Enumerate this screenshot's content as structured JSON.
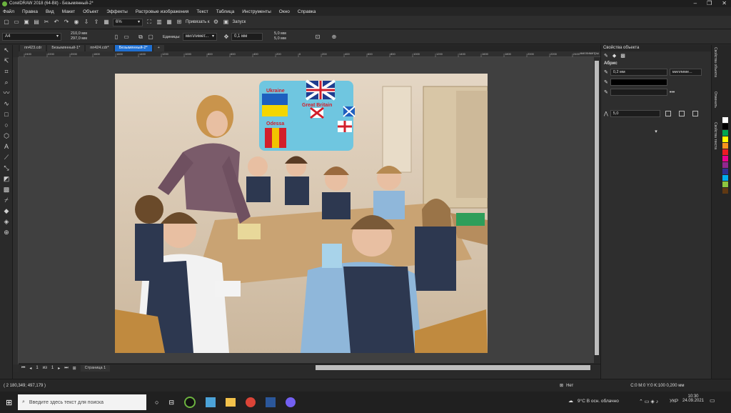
{
  "window": {
    "title": "CorelDRAW 2018 (64-Bit) - Безымянный-2*"
  },
  "menu": {
    "items": [
      "Файл",
      "Правка",
      "Вид",
      "Макет",
      "Объект",
      "Эффекты",
      "Растровые изображения",
      "Текст",
      "Таблица",
      "Инструменты",
      "Окно",
      "Справка"
    ]
  },
  "toolbar": {
    "zoom": "6%",
    "snap_label": "Привязать к",
    "launch_label": "Запуск"
  },
  "propbar": {
    "page_size": "A4",
    "width": "210,0 мм",
    "height": "297,0 мм",
    "units_label": "Единицы:",
    "units_value": "миллимет...",
    "nudge": "0,1 мм",
    "dup_x": "5,0 мм",
    "dup_y": "5,0 мм"
  },
  "tabs": [
    "пп423.cdr",
    "Безымянный-1*",
    "пп424.cdr*",
    "Безымянный-2*"
  ],
  "ruler": {
    "h_ticks": [
      "2400",
      "2200",
      "2000",
      "1800",
      "1600",
      "1400",
      "1200",
      "1000",
      "800",
      "600",
      "400",
      "200",
      "0",
      "200",
      "400",
      "600",
      "800",
      "1000",
      "1200",
      "1400",
      "1600",
      "1800",
      "2000",
      "2200",
      "2400"
    ],
    "units": "миллиметры"
  },
  "page_nav": {
    "current": "1",
    "of": "из",
    "total": "1",
    "page_tab": "Страница 1"
  },
  "photo": {
    "poster": {
      "ukraine": "Ukraine",
      "gb": "Great Britain",
      "odessa": "Odessa"
    }
  },
  "status": {
    "coords": "( 2 180,349; 497,179 )",
    "fill_none": "Нет",
    "outline": "C:0 M:0 Y:0 K:100  0,200 мм"
  },
  "dock": {
    "title": "Свойства объекта",
    "section": "Абрис",
    "outline_width": "0,2 мм",
    "outline_units": "миллиме...",
    "miter": "5,0"
  },
  "side_tabs": [
    "Свойства объекта",
    "Отменить",
    "Свойства текста"
  ],
  "palette_colors": [
    "#ffffff",
    "#000000",
    "#00a651",
    "#ffff00",
    "#f7941d",
    "#ed1c24",
    "#ec008c",
    "#92278f",
    "#2e3192",
    "#00aeef",
    "#8dc63f",
    "#603913"
  ],
  "taskbar": {
    "search_placeholder": "Введите здесь текст для поиска",
    "weather": "9°C  В осн. облачно",
    "lang": "УКР",
    "time": "10:30",
    "date": "24.09.2021"
  }
}
